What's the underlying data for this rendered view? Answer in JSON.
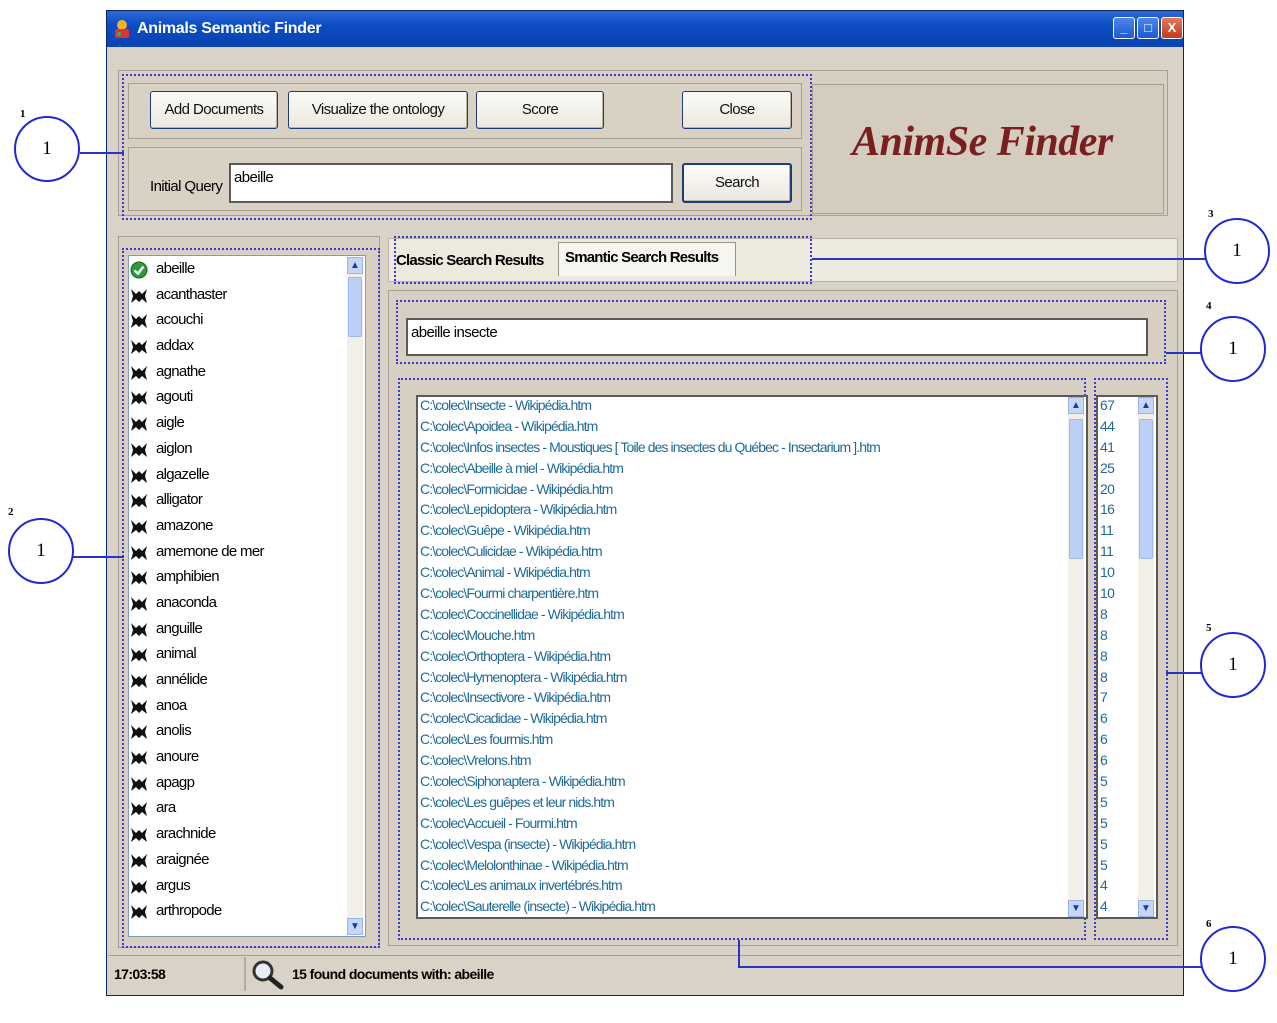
{
  "window": {
    "title": "Animals Semantic Finder",
    "controls": {
      "minimize": "_",
      "maximize": "□",
      "close": "X"
    }
  },
  "toolbar": {
    "add_documents": "Add Documents",
    "visualize": "Visualize the ontology",
    "score": "Score",
    "close": "Close"
  },
  "query": {
    "label": "Initial Query",
    "value": "abeille",
    "search_button": "Search"
  },
  "brand": {
    "logo_text": "AnimSe Finder",
    "color": "#7a1f1f"
  },
  "animals": [
    "abeille",
    "acanthaster",
    "acouchi",
    "addax",
    "agnathe",
    "agouti",
    "aigle",
    "aiglon",
    "algazelle",
    "alligator",
    "amazone",
    "amemone de mer",
    "amphibien",
    "anaconda",
    "anguille",
    "animal",
    "annélide",
    "anoa",
    "anolis",
    "anoure",
    "apagp",
    "ara",
    "arachnide",
    "araignée",
    "argus",
    "arthropode"
  ],
  "tabs": {
    "classic": "Classic Search Results",
    "semantic": "Smantic Search Results"
  },
  "expanded_query": "abeille insecte",
  "results": [
    {
      "doc": "C:\\colec\\Insecte - Wikipédia.htm",
      "score": "67"
    },
    {
      "doc": "C:\\colec\\Apoidea - Wikipédia.htm",
      "score": "44"
    },
    {
      "doc": "C:\\colec\\Infos insectes - Moustiques [ Toile des insectes du Québec - Insectarium ].htm",
      "score": "41"
    },
    {
      "doc": "C:\\colec\\Abeille à miel - Wikipédia.htm",
      "score": "25"
    },
    {
      "doc": "C:\\colec\\Formicidae - Wikipédia.htm",
      "score": "20"
    },
    {
      "doc": "C:\\colec\\Lepidoptera - Wikipédia.htm",
      "score": "16"
    },
    {
      "doc": "C:\\colec\\Guêpe - Wikipédia.htm",
      "score": "11"
    },
    {
      "doc": "C:\\colec\\Culicidae - Wikipédia.htm",
      "score": "11"
    },
    {
      "doc": "C:\\colec\\Animal - Wikipédia.htm",
      "score": "10"
    },
    {
      "doc": "C:\\colec\\Fourmi charpentière.htm",
      "score": "10"
    },
    {
      "doc": "C:\\colec\\Coccinellidae - Wikipédia.htm",
      "score": "8"
    },
    {
      "doc": "C:\\colec\\Mouche.htm",
      "score": "8"
    },
    {
      "doc": "C:\\colec\\Orthoptera - Wikipédia.htm",
      "score": "8"
    },
    {
      "doc": "C:\\colec\\Hymenoptera - Wikipédia.htm",
      "score": "8"
    },
    {
      "doc": "C:\\colec\\Insectivore - Wikipédia.htm",
      "score": "7"
    },
    {
      "doc": "C:\\colec\\Cicadidae - Wikipédia.htm",
      "score": "6"
    },
    {
      "doc": "C:\\colec\\Les fourmis.htm",
      "score": "6"
    },
    {
      "doc": "C:\\colec\\Vrelons.htm",
      "score": "6"
    },
    {
      "doc": "C:\\colec\\Siphonaptera - Wikipédia.htm",
      "score": "5"
    },
    {
      "doc": "C:\\colec\\Les guêpes et leur nids.htm",
      "score": "5"
    },
    {
      "doc": "C:\\colec\\Accueil - Fourmi.htm",
      "score": "5"
    },
    {
      "doc": "C:\\colec\\Vespa (insecte) - Wikipédia.htm",
      "score": "5"
    },
    {
      "doc": "C:\\colec\\Melolonthinae - Wikipédia.htm",
      "score": "5"
    },
    {
      "doc": "C:\\colec\\Les animaux invertébrés.htm",
      "score": "4"
    },
    {
      "doc": "C:\\colec\\Sauterelle (insecte) - Wikipédia.htm",
      "score": "4"
    }
  ],
  "status": {
    "time": "17:03:58",
    "message": "15 found documents with: abeille"
  },
  "callouts": {
    "c1": {
      "number": "1",
      "label": "1"
    },
    "c2": {
      "number": "2",
      "label": "1"
    },
    "c3": {
      "number": "3",
      "label": "1"
    },
    "c4": {
      "number": "4",
      "label": "1"
    },
    "c5": {
      "number": "5",
      "label": "1"
    },
    "c6": {
      "number": "6",
      "label": "1"
    }
  },
  "colors": {
    "titlebar": "#0b4cc4",
    "window_bg": "#d9d2c6",
    "annotation": "#2a33c8",
    "link_text": "#1f6a96"
  },
  "icons": {
    "app": "app-icon",
    "search": "magnifier-icon",
    "animal": "animal-silhouette-icon",
    "selected": "check-icon"
  }
}
